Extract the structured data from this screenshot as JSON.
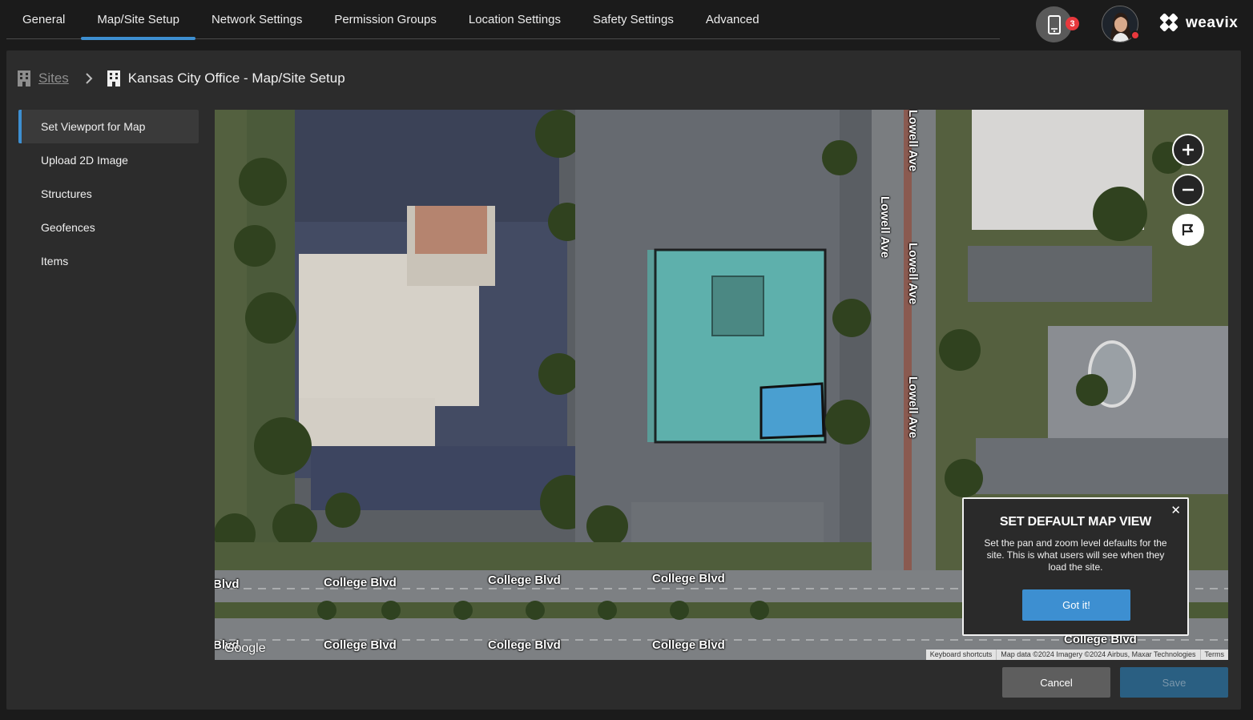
{
  "tabs": [
    {
      "label": "General"
    },
    {
      "label": "Map/Site Setup",
      "active": true
    },
    {
      "label": "Network Settings"
    },
    {
      "label": "Permission Groups"
    },
    {
      "label": "Location Settings"
    },
    {
      "label": "Safety Settings"
    },
    {
      "label": "Advanced"
    }
  ],
  "header": {
    "device_badge_count": "3",
    "device_icon": "mobile-device-icon",
    "avatar_icon": "user-avatar",
    "logo_icon": "weavix-logo-icon",
    "logo_text": "weavix"
  },
  "breadcrumb": {
    "root_label": "Sites",
    "root_icon": "building-icon",
    "separator_icon": "chevron-right-icon",
    "current_icon": "building-icon",
    "current_label": "Kansas City Office - Map/Site Setup"
  },
  "sidebar": {
    "items": [
      {
        "label": "Set Viewport for Map",
        "active": true
      },
      {
        "label": "Upload 2D Image"
      },
      {
        "label": "Structures"
      },
      {
        "label": "Geofences"
      },
      {
        "label": "Items"
      }
    ]
  },
  "map": {
    "road_labels": {
      "lowell_1": "Lowell Ave",
      "lowell_2": "Lowell Ave",
      "lowell_3": "Lowell Ave",
      "lowell_4": "Lowell Ave",
      "college_1": "College Blvd",
      "college_2": "College Blvd",
      "college_3": "College Blvd",
      "college_4": "College Blvd",
      "college_5": "College Blvd",
      "college_6": "College Blvd",
      "college_7": "College Blvd",
      "blvd_1": "Blvd",
      "blvd_2": "Blvd"
    },
    "google_mark": "Google",
    "controls": {
      "zoom_in_icon": "plus-icon",
      "zoom_out_icon": "minus-icon",
      "viewport_icon": "flag-frame-icon"
    },
    "attribution": {
      "shortcuts": "Keyboard shortcuts",
      "data": "Map data ©2024 Imagery ©2024 Airbus, Maxar Technologies",
      "terms": "Terms"
    },
    "colors": {
      "structure_fill": "#5fb4b0",
      "structure_inner": "#4a9fd0"
    }
  },
  "popover": {
    "title": "SET DEFAULT MAP VIEW",
    "body": "Set the pan and zoom level defaults for the site. This is what users will see when they load the site.",
    "button": "Got it!",
    "close_icon": "close-icon"
  },
  "actions": {
    "cancel": "Cancel",
    "save": "Save"
  },
  "colors": {
    "accent": "#3d8fd1",
    "badge": "#e8383d",
    "panel_bg": "#2c2c2c",
    "page_bg": "#1b1b1b"
  }
}
